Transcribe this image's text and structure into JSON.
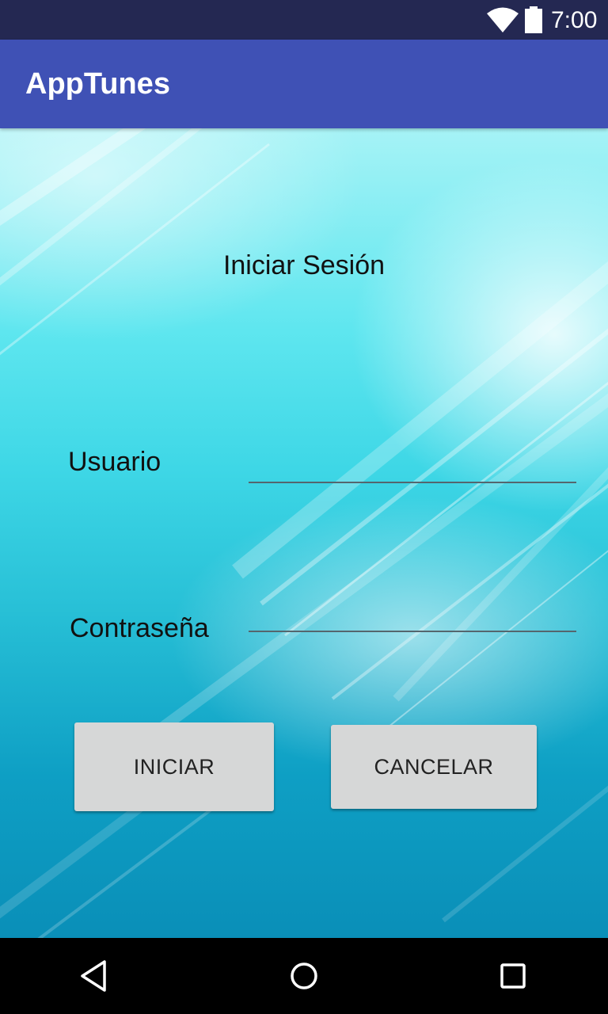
{
  "status_bar": {
    "time": "7:00",
    "icons": [
      "wifi-icon",
      "battery-icon"
    ]
  },
  "app_bar": {
    "title": "AppTunes"
  },
  "login": {
    "title": "Iniciar Sesión",
    "username_label": "Usuario",
    "username_value": "",
    "password_label": "Contraseña",
    "password_value": "",
    "login_button": "INICIAR",
    "cancel_button": "CANCELAR"
  },
  "nav_bar": {
    "icons": [
      "back-icon",
      "home-icon",
      "recents-icon"
    ]
  },
  "colors": {
    "status_bar": "#242852",
    "app_bar": "#3f51b5",
    "button": "#d6d7d7",
    "background_top": "#a6f3f6",
    "background_bottom": "#0a8fb8"
  }
}
